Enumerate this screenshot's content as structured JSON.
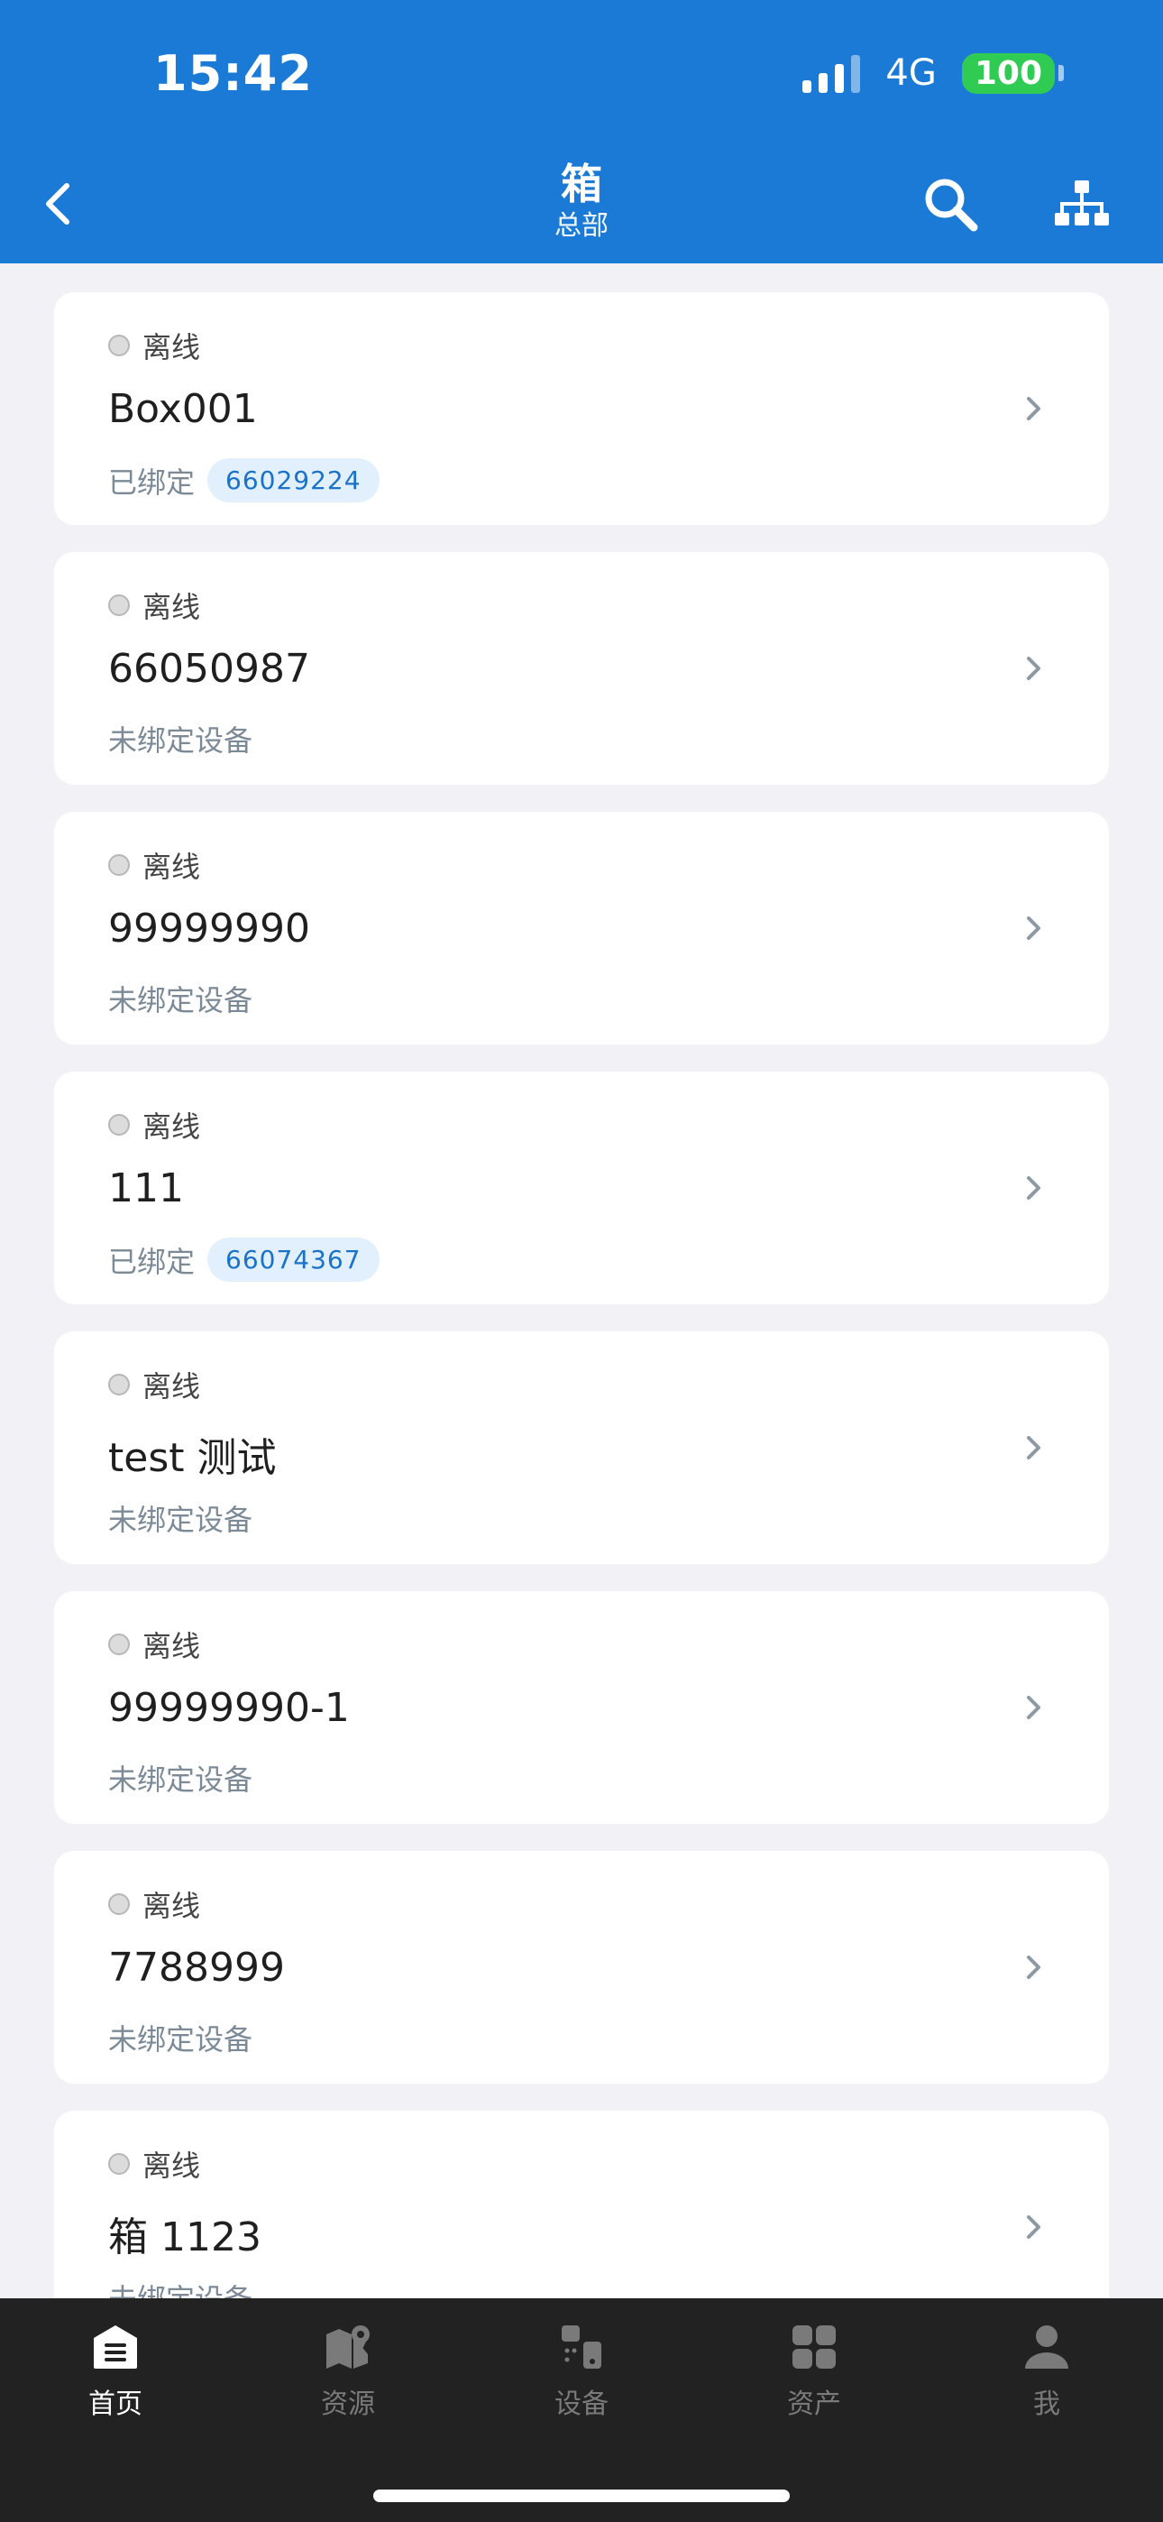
{
  "status_bar": {
    "time": "15:42",
    "network": "4G",
    "battery": "100"
  },
  "nav": {
    "title": "箱",
    "subtitle": "总部"
  },
  "items": [
    {
      "status": "离线",
      "name": "Box001",
      "bind_text": "已绑定",
      "device_id": "66029224"
    },
    {
      "status": "离线",
      "name": "66050987",
      "bind_text": "未绑定设备",
      "device_id": ""
    },
    {
      "status": "离线",
      "name": "99999990",
      "bind_text": "未绑定设备",
      "device_id": ""
    },
    {
      "status": "离线",
      "name": "111",
      "bind_text": "已绑定",
      "device_id": "66074367"
    },
    {
      "status": "离线",
      "name": "test 测试",
      "bind_text": "未绑定设备",
      "device_id": ""
    },
    {
      "status": "离线",
      "name": "99999990-1",
      "bind_text": "未绑定设备",
      "device_id": ""
    },
    {
      "status": "离线",
      "name": "7788999",
      "bind_text": "未绑定设备",
      "device_id": ""
    },
    {
      "status": "离线",
      "name": "箱 1123",
      "bind_text": "未绑定设备",
      "device_id": ""
    }
  ],
  "tabs": [
    {
      "label": "首页",
      "icon": "home-icon",
      "active": true
    },
    {
      "label": "资源",
      "icon": "map-pin-icon",
      "active": false
    },
    {
      "label": "设备",
      "icon": "device-icon",
      "active": false
    },
    {
      "label": "资产",
      "icon": "grid-icon",
      "active": false
    },
    {
      "label": "我",
      "icon": "user-icon",
      "active": false
    }
  ],
  "colors": {
    "header": "#1a7ad6",
    "tabbar": "#222222",
    "tag_bg": "#e2f0fd",
    "tag_text": "#1a72c9"
  }
}
